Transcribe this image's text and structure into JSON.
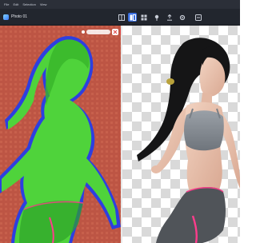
{
  "app": {
    "file_name": "Photo 01"
  },
  "menu": {
    "items": [
      "File",
      "Edit",
      "Selection",
      "View"
    ]
  },
  "toolbar": {
    "buttons": [
      {
        "name": "layout-icon",
        "active": false
      },
      {
        "name": "compare-icon",
        "active": true
      },
      {
        "name": "grid-icon",
        "active": false
      },
      {
        "name": "pin-icon",
        "active": false
      },
      {
        "name": "export-icon",
        "active": false
      },
      {
        "name": "settings-icon",
        "active": false
      },
      {
        "name": "more-icon",
        "active": false
      }
    ]
  },
  "canvas": {
    "left_pane": {
      "mask_color": "#4fd33b",
      "outline_color": "#2d3fe0",
      "background": "#c25a47"
    },
    "right_pane": {
      "background": "transparent-checkerboard"
    },
    "zoom_control": {
      "label": ""
    }
  },
  "colors": {
    "accent": "#3a6fe0",
    "toolbar_bg": "#22262e",
    "pink_trim": "#ff3c8c"
  }
}
